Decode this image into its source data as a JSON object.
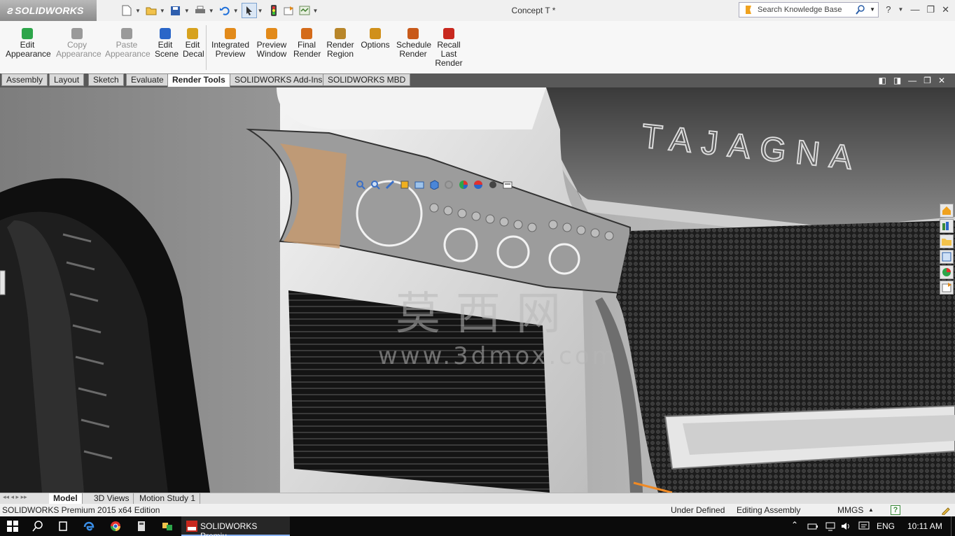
{
  "app": {
    "brand": "SOLIDWORKS",
    "document_title": "Concept T *",
    "search_placeholder": "Search Knowledge Base"
  },
  "ribbon": {
    "buttons": [
      {
        "label": "Edit\nAppearance",
        "enabled": true
      },
      {
        "label": "Copy\nAppearance",
        "enabled": false
      },
      {
        "label": "Paste\nAppearance",
        "enabled": false
      },
      {
        "label": "Edit\nScene",
        "enabled": true
      },
      {
        "label": "Edit\nDecal",
        "enabled": true
      },
      {
        "label": "Integrated\nPreview",
        "enabled": true
      },
      {
        "label": "Preview\nWindow",
        "enabled": true
      },
      {
        "label": "Final\nRender",
        "enabled": true
      },
      {
        "label": "Render\nRegion",
        "enabled": true
      },
      {
        "label": "Options",
        "enabled": true
      },
      {
        "label": "Schedule\nRender",
        "enabled": true
      },
      {
        "label": "Recall\nLast\nRender",
        "enabled": true
      }
    ]
  },
  "command_tabs": [
    {
      "label": "Assembly",
      "active": false
    },
    {
      "label": "Layout",
      "active": false
    },
    {
      "label": "Sketch",
      "active": false
    },
    {
      "label": "Evaluate",
      "active": false
    },
    {
      "label": "Render Tools",
      "active": true
    },
    {
      "label": "SOLIDWORKS Add-Ins",
      "active": false
    },
    {
      "label": "SOLIDWORKS MBD",
      "active": false
    }
  ],
  "viewport": {
    "badge_text": "TAJAGNA",
    "watermark": {
      "cn": "莫西网",
      "url": "www.3dmox.com"
    }
  },
  "bottom_tabs": [
    {
      "label": "Model",
      "active": true
    },
    {
      "label": "3D Views",
      "active": false
    },
    {
      "label": "Motion Study 1",
      "active": false
    }
  ],
  "status": {
    "edition": "SOLIDWORKS Premium 2015 x64 Edition",
    "state": "Under Defined",
    "mode": "Editing Assembly",
    "units": "MMGS"
  },
  "taskbar": {
    "active_app": "SOLIDWORKS Premiu...",
    "language": "ENG",
    "time": "10:11 AM"
  },
  "colors": {
    "accent_blue": "#1e6fd9",
    "tab_bar": "#595959",
    "taskbar": "#0b0b0b"
  }
}
